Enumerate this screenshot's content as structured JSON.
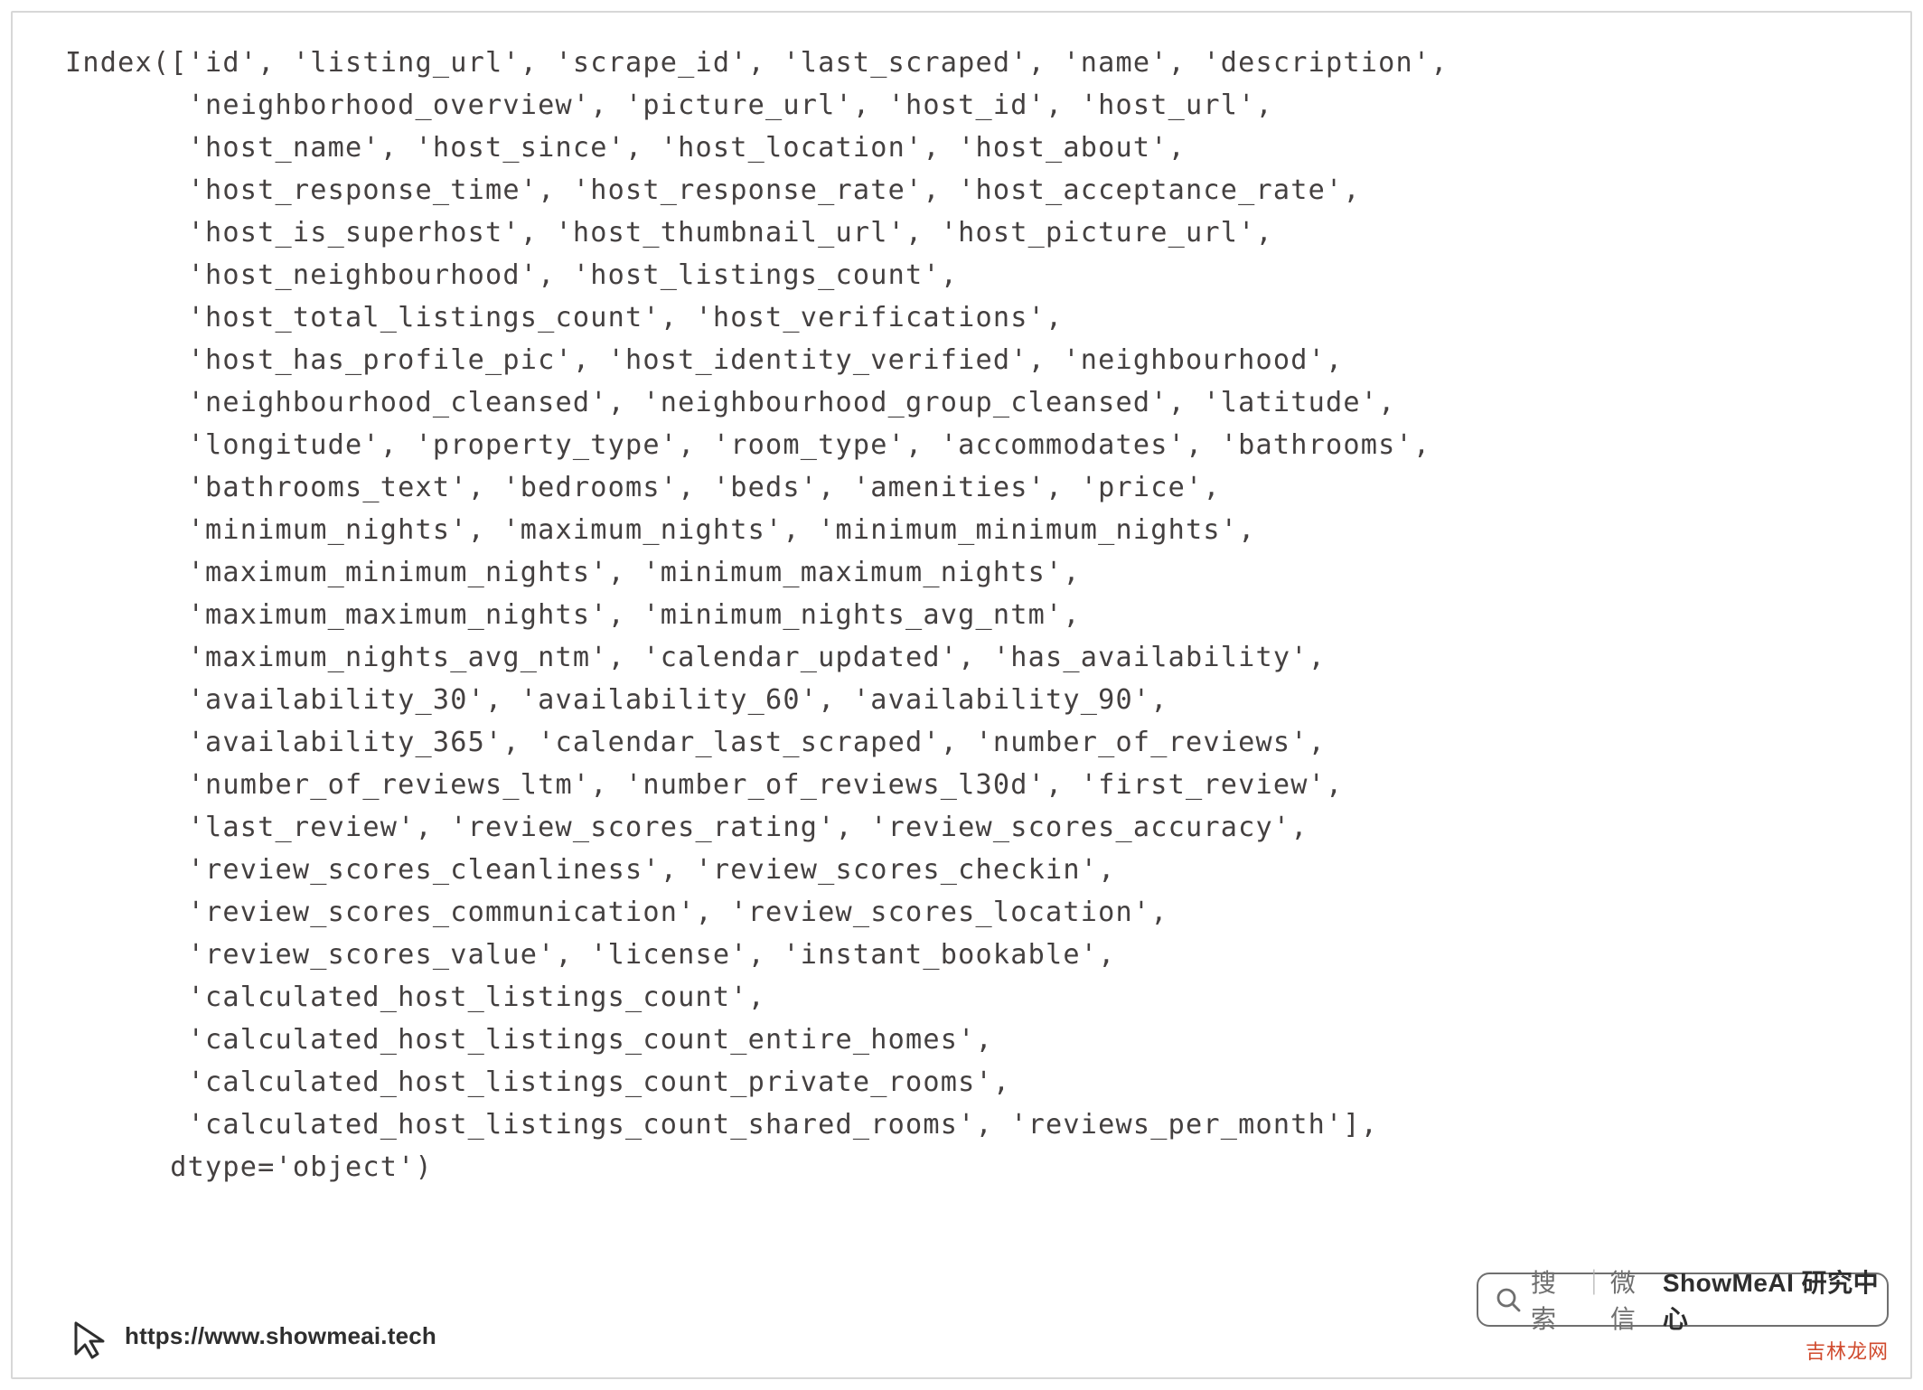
{
  "index_columns": [
    "id",
    "listing_url",
    "scrape_id",
    "last_scraped",
    "name",
    "description",
    "neighborhood_overview",
    "picture_url",
    "host_id",
    "host_url",
    "host_name",
    "host_since",
    "host_location",
    "host_about",
    "host_response_time",
    "host_response_rate",
    "host_acceptance_rate",
    "host_is_superhost",
    "host_thumbnail_url",
    "host_picture_url",
    "host_neighbourhood",
    "host_listings_count",
    "host_total_listings_count",
    "host_verifications",
    "host_has_profile_pic",
    "host_identity_verified",
    "neighbourhood",
    "neighbourhood_cleansed",
    "neighbourhood_group_cleansed",
    "latitude",
    "longitude",
    "property_type",
    "room_type",
    "accommodates",
    "bathrooms",
    "bathrooms_text",
    "bedrooms",
    "beds",
    "amenities",
    "price",
    "minimum_nights",
    "maximum_nights",
    "minimum_minimum_nights",
    "maximum_minimum_nights",
    "minimum_maximum_nights",
    "maximum_maximum_nights",
    "minimum_nights_avg_ntm",
    "maximum_nights_avg_ntm",
    "calendar_updated",
    "has_availability",
    "availability_30",
    "availability_60",
    "availability_90",
    "availability_365",
    "calendar_last_scraped",
    "number_of_reviews",
    "number_of_reviews_ltm",
    "number_of_reviews_l30d",
    "first_review",
    "last_review",
    "review_scores_rating",
    "review_scores_accuracy",
    "review_scores_cleanliness",
    "review_scores_checkin",
    "review_scores_communication",
    "review_scores_location",
    "review_scores_value",
    "license",
    "instant_bookable",
    "calculated_host_listings_count",
    "calculated_host_listings_count_entire_homes",
    "calculated_host_listings_count_private_rooms",
    "calculated_host_listings_count_shared_rooms",
    "reviews_per_month"
  ],
  "dtype": "object",
  "code_text": "Index(['id', 'listing_url', 'scrape_id', 'last_scraped', 'name', 'description',\n       'neighborhood_overview', 'picture_url', 'host_id', 'host_url',\n       'host_name', 'host_since', 'host_location', 'host_about',\n       'host_response_time', 'host_response_rate', 'host_acceptance_rate',\n       'host_is_superhost', 'host_thumbnail_url', 'host_picture_url',\n       'host_neighbourhood', 'host_listings_count',\n       'host_total_listings_count', 'host_verifications',\n       'host_has_profile_pic', 'host_identity_verified', 'neighbourhood',\n       'neighbourhood_cleansed', 'neighbourhood_group_cleansed', 'latitude',\n       'longitude', 'property_type', 'room_type', 'accommodates', 'bathrooms',\n       'bathrooms_text', 'bedrooms', 'beds', 'amenities', 'price',\n       'minimum_nights', 'maximum_nights', 'minimum_minimum_nights',\n       'maximum_minimum_nights', 'minimum_maximum_nights',\n       'maximum_maximum_nights', 'minimum_nights_avg_ntm',\n       'maximum_nights_avg_ntm', 'calendar_updated', 'has_availability',\n       'availability_30', 'availability_60', 'availability_90',\n       'availability_365', 'calendar_last_scraped', 'number_of_reviews',\n       'number_of_reviews_ltm', 'number_of_reviews_l30d', 'first_review',\n       'last_review', 'review_scores_rating', 'review_scores_accuracy',\n       'review_scores_cleanliness', 'review_scores_checkin',\n       'review_scores_communication', 'review_scores_location',\n       'review_scores_value', 'license', 'instant_bookable',\n       'calculated_host_listings_count',\n       'calculated_host_listings_count_entire_homes',\n       'calculated_host_listings_count_private_rooms',\n       'calculated_host_listings_count_shared_rooms', 'reviews_per_month'],\n      dtype='object')",
  "footer": {
    "url": "https://www.showmeai.tech"
  },
  "pill": {
    "search_label": "搜索",
    "wechat_label": "微信",
    "brand": "ShowMeAI 研究中心"
  },
  "corner_brand": "吉林龙网"
}
